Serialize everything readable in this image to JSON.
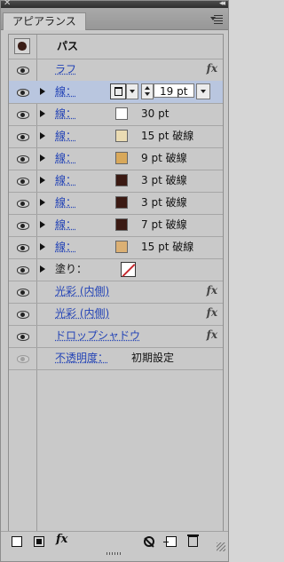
{
  "panel": {
    "tab_label": "アピアランス",
    "close_glyph": "✕",
    "collapse_glyph": "◂◂"
  },
  "header": {
    "title": "パス",
    "icon": "path-thumbnail-icon"
  },
  "rows": [
    {
      "type": "effect",
      "label": "ラフ",
      "fx": "fx"
    },
    {
      "type": "stroke",
      "label": "線：",
      "selected": true,
      "weight": "19 pt"
    },
    {
      "type": "stroke",
      "label": "線：",
      "swatch": "#ffffff",
      "value": "30 pt"
    },
    {
      "type": "stroke",
      "label": "線：",
      "swatch": "#eadbb3",
      "value": "15 pt 破線"
    },
    {
      "type": "stroke",
      "label": "線：",
      "swatch": "#d8a85a",
      "value": "9 pt 破線"
    },
    {
      "type": "stroke",
      "label": "線：",
      "swatch": "#3b1a13",
      "value": "3 pt 破線"
    },
    {
      "type": "stroke",
      "label": "線：",
      "swatch": "#3b1a13",
      "value": "3 pt 破線"
    },
    {
      "type": "stroke",
      "label": "線：",
      "swatch": "#3b1a13",
      "value": "7 pt 破線"
    },
    {
      "type": "stroke",
      "label": "線：",
      "swatch": "#dbb074",
      "value": "15 pt 破線"
    },
    {
      "type": "fill",
      "label": "塗り："
    },
    {
      "type": "effect",
      "label": "光彩 (内側)",
      "fx": "fx"
    },
    {
      "type": "effect",
      "label": "光彩 (内側)",
      "fx": "fx"
    },
    {
      "type": "effect",
      "label": "ドロップシャドウ",
      "fx": "fx"
    },
    {
      "type": "opacity",
      "label": "不透明度：",
      "value": "初期設定"
    }
  ],
  "footer": {
    "fx_label": "fx"
  },
  "colors": {
    "selected_row": "#b9c6df",
    "link_blue": "#2343b6"
  }
}
